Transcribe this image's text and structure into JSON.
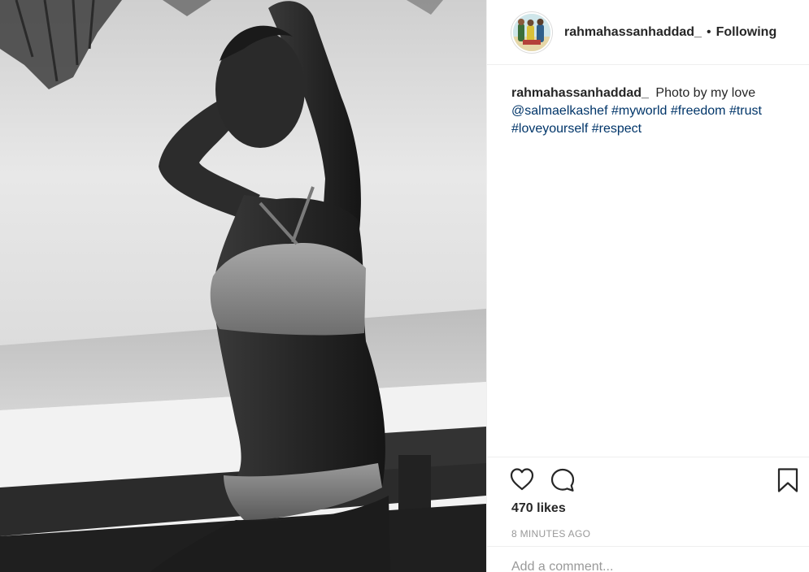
{
  "post": {
    "author": "rahmahassanhaddad_",
    "separator": "•",
    "follow_status": "Following",
    "caption": {
      "username": "rahmahassanhaddad_",
      "text": "Photo by my love",
      "mention": "@salmaelkashef",
      "hashtags": [
        "#myworld",
        "#freedom",
        "#trust",
        "#loveyourself",
        "#respect"
      ]
    },
    "likes": "470 likes",
    "timestamp": "8 MINUTES AGO",
    "comment_placeholder": "Add a comment..."
  },
  "icons": {
    "like": "heart-icon",
    "comment": "comment-bubble-icon",
    "save": "bookmark-icon"
  },
  "colors": {
    "text": "#262626",
    "link": "#003569",
    "muted": "#999999",
    "divider": "#efefef"
  }
}
